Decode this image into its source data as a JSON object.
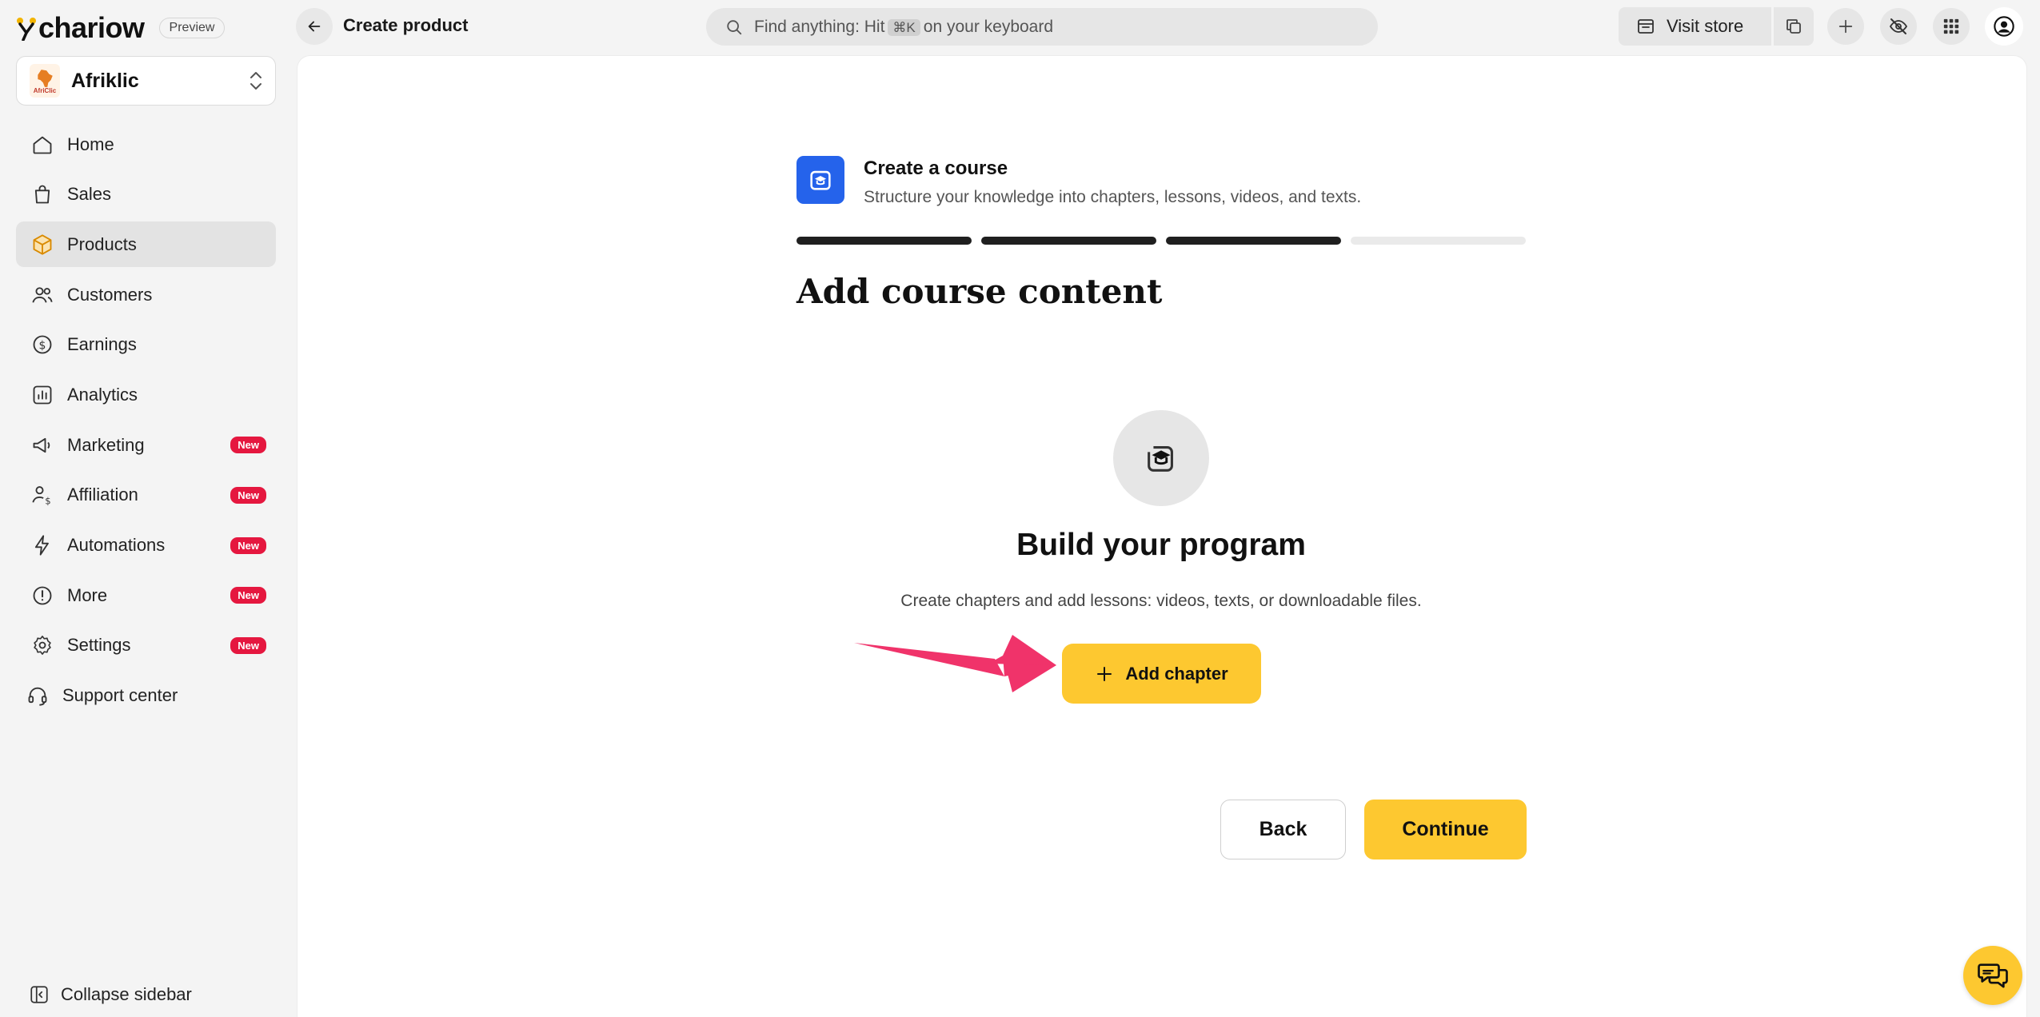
{
  "brand": {
    "name": "chariow",
    "badge": "Preview"
  },
  "topbar": {
    "page_title": "Create product",
    "search": {
      "prefix": "Find anything: Hit",
      "shortcut": "⌘K",
      "suffix": "on your keyboard"
    },
    "visit_store_label": "Visit store"
  },
  "store": {
    "name": "Afriklic",
    "logo_text": "AfriClic"
  },
  "sidebar": {
    "items": [
      {
        "label": "Home",
        "icon": "home-icon"
      },
      {
        "label": "Sales",
        "icon": "shopping-bag-icon"
      },
      {
        "label": "Products",
        "icon": "package-icon",
        "active": true
      },
      {
        "label": "Customers",
        "icon": "users-icon"
      },
      {
        "label": "Earnings",
        "icon": "dollar-circle-icon"
      },
      {
        "label": "Analytics",
        "icon": "bar-chart-icon"
      },
      {
        "label": "Marketing",
        "icon": "megaphone-icon",
        "badge": "New"
      },
      {
        "label": "Affiliation",
        "icon": "user-dollar-icon",
        "badge": "New"
      },
      {
        "label": "Automations",
        "icon": "lightning-icon",
        "badge": "New"
      },
      {
        "label": "More",
        "icon": "info-circle-icon",
        "badge": "New"
      },
      {
        "label": "Settings",
        "icon": "gear-icon",
        "badge": "New"
      },
      {
        "label": "Support center",
        "icon": "headset-icon"
      }
    ],
    "collapse_label": "Collapse sidebar"
  },
  "course": {
    "title": "Create a course",
    "subtitle": "Structure your knowledge into chapters, lessons, videos, and texts.",
    "progress": {
      "completed_steps": 3,
      "total_steps": 4
    }
  },
  "content": {
    "section_title": "Add course content",
    "empty_title": "Build your program",
    "empty_desc": "Create chapters and add lessons: videos, texts, or downloadable files.",
    "add_chapter_label": "Add chapter"
  },
  "actions": {
    "back_label": "Back",
    "continue_label": "Continue"
  },
  "colors": {
    "accent": "#fdc830",
    "badge_red": "#e5173f",
    "course_blue": "#2563eb",
    "arrow_pink": "#f0336a"
  }
}
